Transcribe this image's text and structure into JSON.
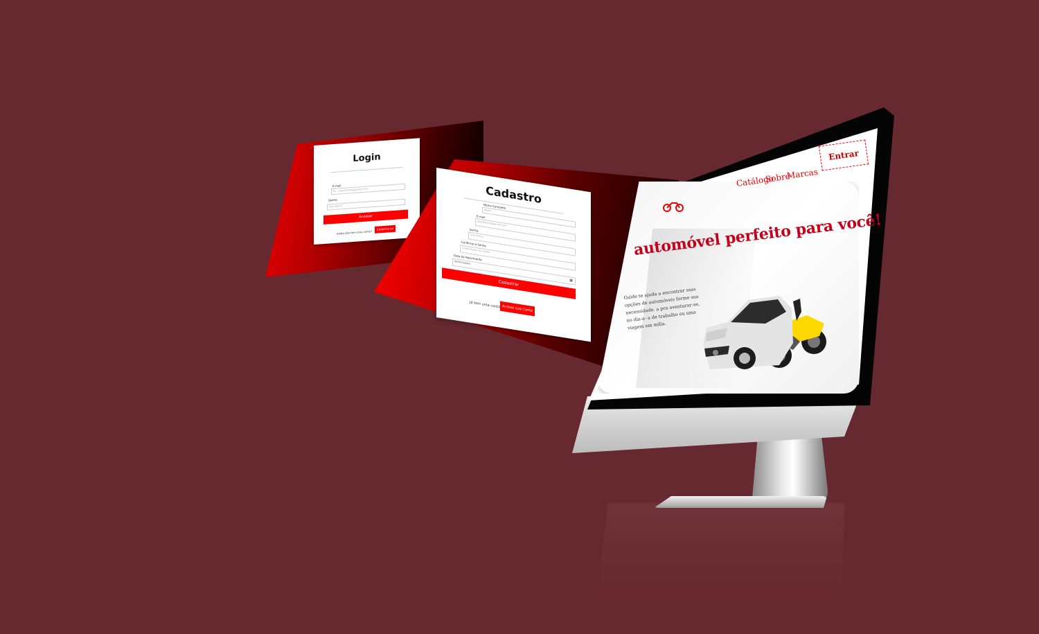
{
  "colors": {
    "background": "#672930",
    "accent_red": "#ff0000",
    "title_red": "#c4001a"
  },
  "login": {
    "title": "Login",
    "email_label": "E-mail",
    "email_placeholder": "ex.: joaodasilva@gmail.com",
    "password_label": "Senha",
    "password_placeholder": "Sua senha",
    "submit_label": "Acessar",
    "no_account_text": "Ainda não tem uma conta?",
    "register_button": "Cadastre-se"
  },
  "register": {
    "title": "Cadastro",
    "name_label": "Nome Completo",
    "name_placeholder": "Nome",
    "email_label": "E-mail",
    "email_placeholder": "joaodasilva@gmail.com",
    "password_label": "Senha",
    "password_placeholder": "Sua senha",
    "confirm_label": "Confirme a Senha",
    "confirm_placeholder": "Confirmação de senha",
    "birth_label": "Data de Nascimento",
    "birth_placeholder": "dd/mm/aaaa",
    "submit_label": "Cadastrar",
    "have_account_text": "Já tem uma conta?",
    "login_button": "Acesse sua Conta"
  },
  "website": {
    "nav": [
      "Catálogo",
      "Sobre",
      "Marcas"
    ],
    "login_button": "Entrar",
    "hero_title": "automóvel perfeito para você!",
    "hero_description": "Guide te ajuda a encontrar ssas opções de automóveis forme sua necessidade. a pra aventurar-se, no dia-a- a de trabalho ou uma viagem em milia."
  },
  "icons": {
    "logo": "motorcycle-logo-icon",
    "calendar": "calendar-icon",
    "hero": "car-and-motorcycle-image"
  }
}
